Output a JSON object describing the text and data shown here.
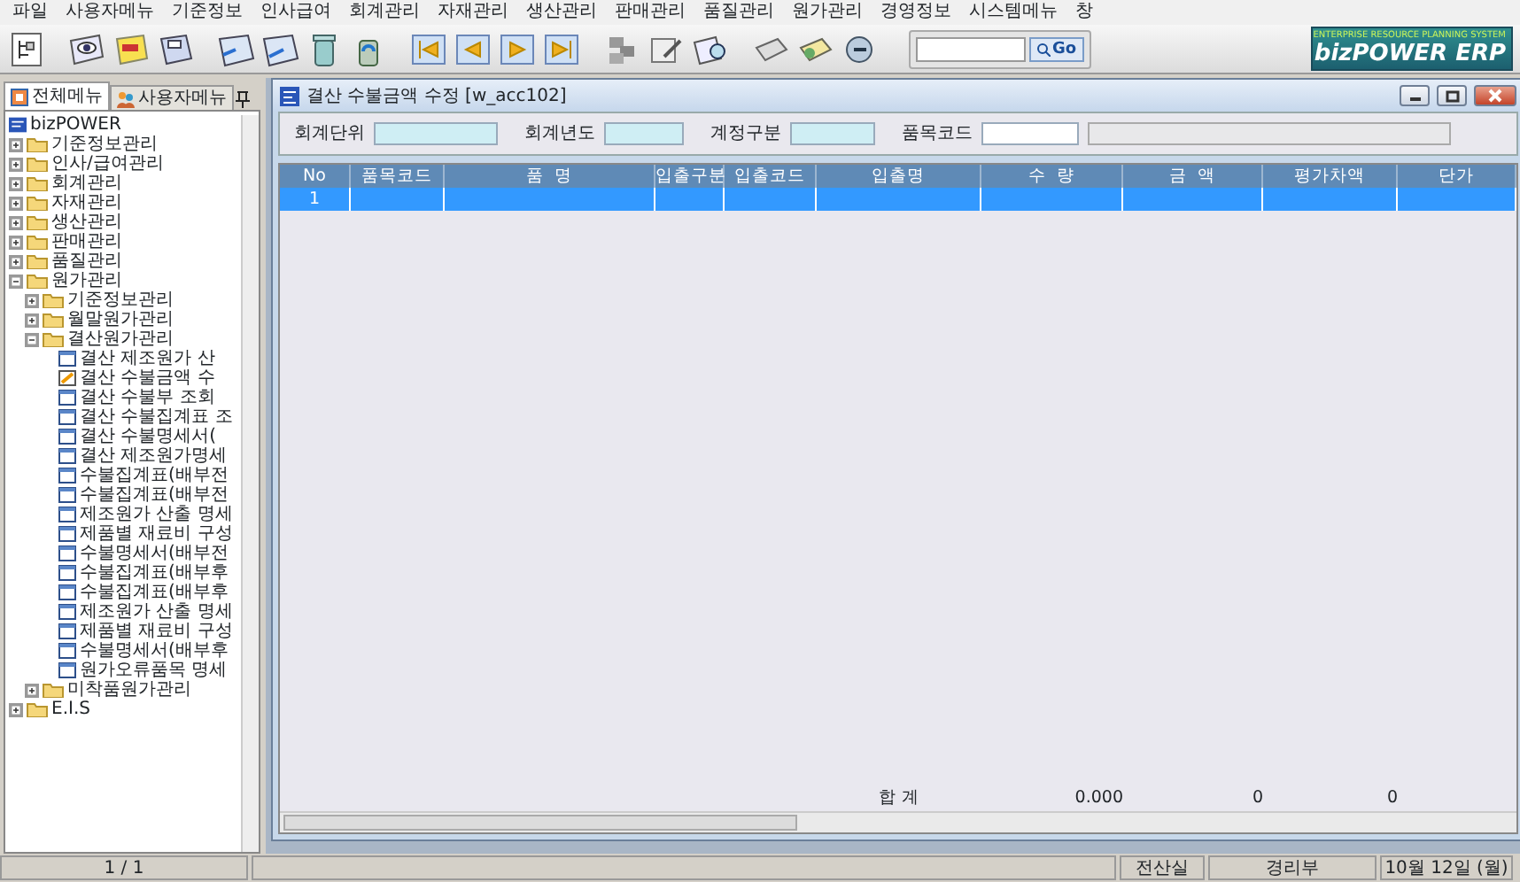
{
  "menu_bar": [
    "파일",
    "사용자메뉴",
    "기준정보",
    "인사급여",
    "회계관리",
    "자재관리",
    "생산관리",
    "판매관리",
    "품질관리",
    "원가관리",
    "경영정보",
    "시스템메뉴",
    "창"
  ],
  "search": {
    "button": "Go"
  },
  "logo": {
    "tagline": "ENTERPRISE RESOURCE PLANNING SYSTEM",
    "name": "bizPOWER ERP"
  },
  "sidebar": {
    "tabs": [
      {
        "label": "전체메뉴",
        "selected": true
      },
      {
        "label": "사용자메뉴",
        "selected": false
      }
    ],
    "tree": {
      "label": "bizPOWER",
      "children": [
        {
          "label": "기준정보관리",
          "expanded": false
        },
        {
          "label": "인사/급여관리",
          "expanded": false
        },
        {
          "label": "회계관리",
          "expanded": false
        },
        {
          "label": "자재관리",
          "expanded": false
        },
        {
          "label": "생산관리",
          "expanded": false
        },
        {
          "label": "판매관리",
          "expanded": false
        },
        {
          "label": "품질관리",
          "expanded": false
        },
        {
          "label": "원가관리",
          "expanded": true,
          "children": [
            {
              "label": "기준정보관리",
              "expanded": false
            },
            {
              "label": "월말원가관리",
              "expanded": false
            },
            {
              "label": "결산원가관리",
              "expanded": true,
              "children": [
                {
                  "label": "결산 제조원가 산",
                  "kind": "form"
                },
                {
                  "label": "결산 수불금액 수",
                  "kind": "open-form"
                },
                {
                  "label": "결산 수불부 조회",
                  "kind": "form"
                },
                {
                  "label": "결산 수불집계표 조",
                  "kind": "form"
                },
                {
                  "label": "결산 수불명세서(",
                  "kind": "form"
                },
                {
                  "label": "결산 제조원가명세",
                  "kind": "form"
                },
                {
                  "label": "수불집계표(배부전",
                  "kind": "form"
                },
                {
                  "label": "수불집계표(배부전",
                  "kind": "form"
                },
                {
                  "label": "제조원가 산출 명세",
                  "kind": "form"
                },
                {
                  "label": "제품별 재료비 구성",
                  "kind": "form"
                },
                {
                  "label": "수불명세서(배부전",
                  "kind": "form"
                },
                {
                  "label": "수불집계표(배부후",
                  "kind": "form"
                },
                {
                  "label": "수불집계표(배부후",
                  "kind": "form"
                },
                {
                  "label": "제조원가 산출 명세",
                  "kind": "form"
                },
                {
                  "label": "제품별 재료비 구성",
                  "kind": "form"
                },
                {
                  "label": "수불명세서(배부후",
                  "kind": "form"
                },
                {
                  "label": "원가오류품목 명세",
                  "kind": "form"
                }
              ]
            },
            {
              "label": "미착품원가관리",
              "expanded": false
            }
          ]
        },
        {
          "label": "E.I.S",
          "expanded": false
        }
      ]
    }
  },
  "window": {
    "title": "결산 수불금액 수정 [w_acc102]"
  },
  "filters": [
    {
      "label": "회계단위",
      "kind": "required"
    },
    {
      "label": "회계년도",
      "kind": "required"
    },
    {
      "label": "계정구분",
      "kind": "required"
    },
    {
      "label": "품목코드",
      "kind": "lookup"
    }
  ],
  "table": {
    "columns": [
      "No",
      "품목코드",
      "품  명",
      "입출구분",
      "입출코드",
      "입출명",
      "수  량",
      "금  액",
      "평가차액",
      "단가"
    ],
    "rows": [
      {
        "cells": [
          "1",
          "",
          "",
          "",
          "",
          "",
          "",
          "",
          "",
          ""
        ],
        "selected": true
      }
    ],
    "totals": {
      "label": "합 계",
      "quantity": "0.000",
      "amount": "0",
      "variance": "0"
    }
  },
  "status_bar": {
    "page": "1 / 1",
    "department": "전산실",
    "team": "경리부",
    "date": "10월 12일 (월)"
  }
}
